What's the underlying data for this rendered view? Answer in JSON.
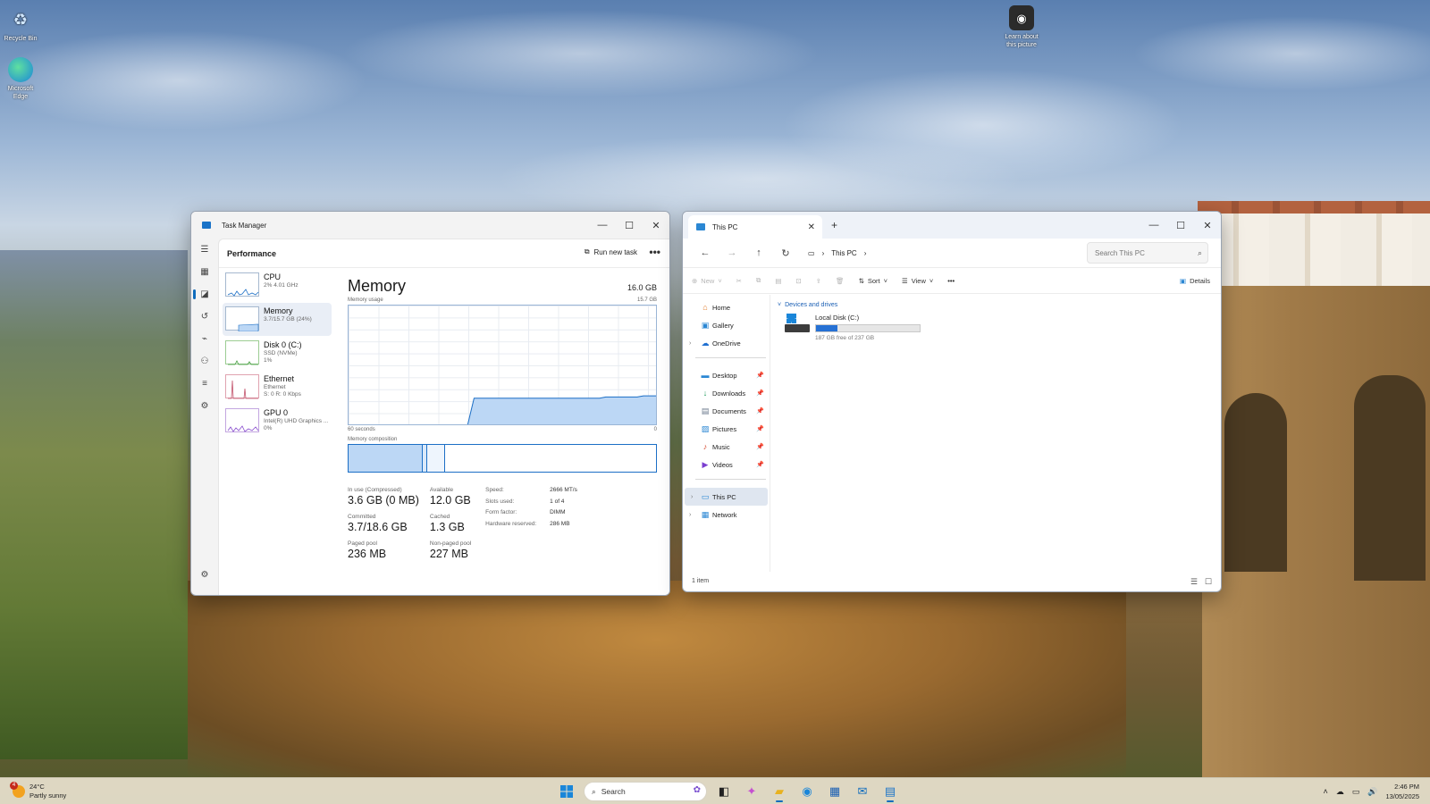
{
  "desktop": {
    "icons": [
      {
        "label": "Recycle Bin",
        "icon": "recycle-bin-icon"
      },
      {
        "label": "Microsoft Edge",
        "icon": "edge-icon"
      },
      {
        "label": "Learn about this picture",
        "icon": "camera-icon"
      }
    ]
  },
  "task_manager": {
    "title": "Task Manager",
    "section": "Performance",
    "run_new_task": "Run new task",
    "more": "•••",
    "rail": [
      "hamburger-icon",
      "processes-icon",
      "performance-icon",
      "app-history-icon",
      "startup-apps-icon",
      "users-icon",
      "details-icon",
      "services-icon",
      "settings-icon"
    ],
    "items": [
      {
        "name": "CPU",
        "sub1": "2%  4.01 GHz",
        "sub2": ""
      },
      {
        "name": "Memory",
        "sub1": "3.7/15.7 GB (24%)",
        "sub2": ""
      },
      {
        "name": "Disk 0 (C:)",
        "sub1": "SSD (NVMe)",
        "sub2": "1%"
      },
      {
        "name": "Ethernet",
        "sub1": "Ethernet",
        "sub2": "S: 0 R: 0 Kbps"
      },
      {
        "name": "GPU 0",
        "sub1": "Intel(R) UHD Graphics ...",
        "sub2": "0%"
      }
    ],
    "memory": {
      "title": "Memory",
      "total": "16.0 GB",
      "usage_label": "Memory usage",
      "usage_max": "15.7 GB",
      "axis_left": "60 seconds",
      "axis_right": "0",
      "composition_label": "Memory composition",
      "usage_history_percent": [
        null,
        null,
        null,
        null,
        null,
        null,
        null,
        null,
        null,
        null,
        null,
        null,
        null,
        null,
        null,
        null,
        null,
        null,
        null,
        0,
        22,
        22,
        22,
        22,
        22,
        22,
        22,
        22,
        22,
        22,
        22,
        22,
        22,
        22,
        22,
        22,
        22,
        22,
        22,
        22,
        22,
        23,
        23,
        23,
        23,
        23,
        23,
        24,
        24,
        24
      ],
      "stats": {
        "in_use_label": "In use (Compressed)",
        "in_use": "3.6 GB (0 MB)",
        "available_label": "Available",
        "available": "12.0 GB",
        "committed_label": "Committed",
        "committed": "3.7/18.6 GB",
        "cached_label": "Cached",
        "cached": "1.3 GB",
        "paged_label": "Paged pool",
        "paged": "236 MB",
        "nonpaged_label": "Non-paged pool",
        "nonpaged": "227 MB"
      },
      "specs": [
        {
          "k": "Speed:",
          "v": "2666 MT/s"
        },
        {
          "k": "Slots used:",
          "v": "1 of 4"
        },
        {
          "k": "Form factor:",
          "v": "DIMM"
        },
        {
          "k": "Hardware reserved:",
          "v": "286 MB"
        }
      ]
    }
  },
  "explorer": {
    "tab_title": "This PC",
    "new_tab": "+",
    "breadcrumb": "This PC",
    "search_placeholder": "Search This PC",
    "commands": {
      "new": "New",
      "sort": "Sort",
      "view": "View",
      "more": "•••",
      "details": "Details"
    },
    "nav": [
      {
        "label": "Home",
        "icon": "home-icon",
        "color": "#e07b2a"
      },
      {
        "label": "Gallery",
        "icon": "gallery-icon",
        "color": "#2b87d3"
      },
      {
        "label": "OneDrive",
        "icon": "onedrive-icon",
        "color": "#1f6fd1"
      },
      {
        "label": "Desktop",
        "icon": "desktop-icon",
        "color": "#2b87d3"
      },
      {
        "label": "Downloads",
        "icon": "download-icon",
        "color": "#1e9a5a"
      },
      {
        "label": "Documents",
        "icon": "documents-icon",
        "color": "#6b7a8c"
      },
      {
        "label": "Pictures",
        "icon": "pictures-icon",
        "color": "#2b87d3"
      },
      {
        "label": "Music",
        "icon": "music-icon",
        "color": "#d3452b"
      },
      {
        "label": "Videos",
        "icon": "videos-icon",
        "color": "#7b3fd0"
      },
      {
        "label": "This PC",
        "icon": "this-pc-icon",
        "color": "#2b87d3"
      },
      {
        "label": "Network",
        "icon": "network-icon",
        "color": "#2b87d3"
      }
    ],
    "group": "Devices and drives",
    "drive": {
      "name": "Local Disk (C:)",
      "free": "187 GB free of 237 GB",
      "used_fraction": 0.21
    },
    "status": "1 item"
  },
  "taskbar": {
    "temp": "24°C",
    "condition": "Partly sunny",
    "badge": "4",
    "search": "Search",
    "apps": [
      "task-view-icon",
      "copilot-icon",
      "file-explorer-icon",
      "edge-icon",
      "store-icon",
      "outlook-icon",
      "task-manager-icon"
    ],
    "time": "2:46 PM",
    "date": "13/05/2025"
  }
}
